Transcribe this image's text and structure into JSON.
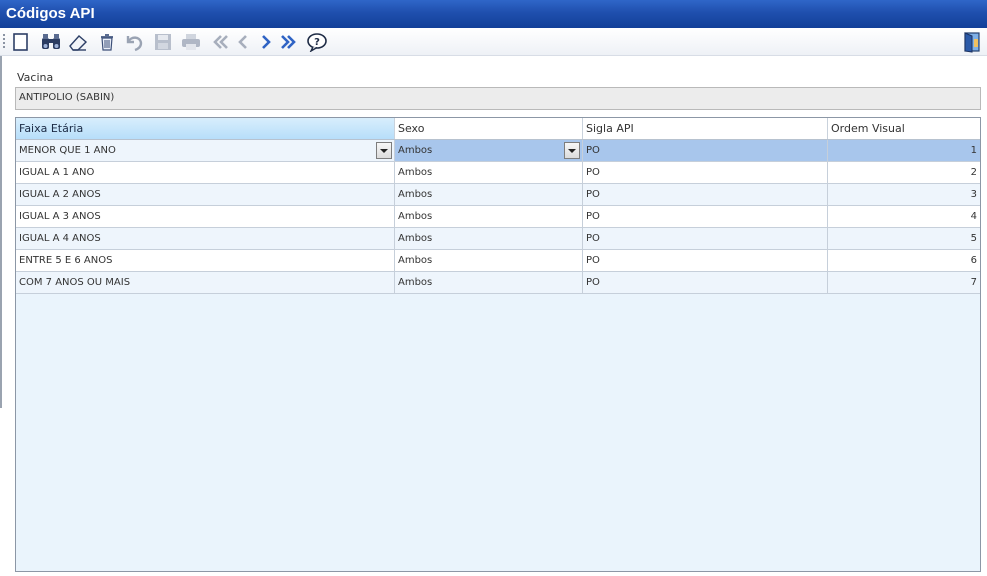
{
  "window": {
    "title": "Códigos API"
  },
  "toolbar": {
    "icons": [
      "new-icon",
      "binoculars-icon",
      "eraser-icon",
      "trash-icon",
      "undo-icon",
      "save-icon",
      "print-icon",
      "first-icon",
      "prev-icon",
      "next-icon",
      "last-icon",
      "help-icon",
      "exit-door-icon"
    ]
  },
  "vacina": {
    "label": "Vacina",
    "value": "ANTIPOLIO (SABIN)"
  },
  "grid": {
    "columns": [
      "Faixa Etária",
      "Sexo",
      "Sigla API",
      "Ordem Visual"
    ],
    "rows": [
      {
        "faixa": "MENOR QUE 1 ANO",
        "sexo": "Ambos",
        "sigla": "PO",
        "ordem": "1"
      },
      {
        "faixa": "IGUAL A 1 ANO",
        "sexo": "Ambos",
        "sigla": "PO",
        "ordem": "2"
      },
      {
        "faixa": "IGUAL A 2 ANOS",
        "sexo": "Ambos",
        "sigla": "PO",
        "ordem": "3"
      },
      {
        "faixa": "IGUAL A 3 ANOS",
        "sexo": "Ambos",
        "sigla": "PO",
        "ordem": "4"
      },
      {
        "faixa": "IGUAL A 4 ANOS",
        "sexo": "Ambos",
        "sigla": "PO",
        "ordem": "5"
      },
      {
        "faixa": "ENTRE 5 E 6 ANOS",
        "sexo": "Ambos",
        "sigla": "PO",
        "ordem": "6"
      },
      {
        "faixa": "COM 7 ANOS OU MAIS",
        "sexo": "Ambos",
        "sigla": "PO",
        "ordem": "7"
      }
    ]
  },
  "colors": {
    "title_bar": "#1f4fae",
    "header_selected": "#b7defa",
    "row_highlight": "#a8c6ec",
    "grid_background": "#eaf4fc"
  }
}
